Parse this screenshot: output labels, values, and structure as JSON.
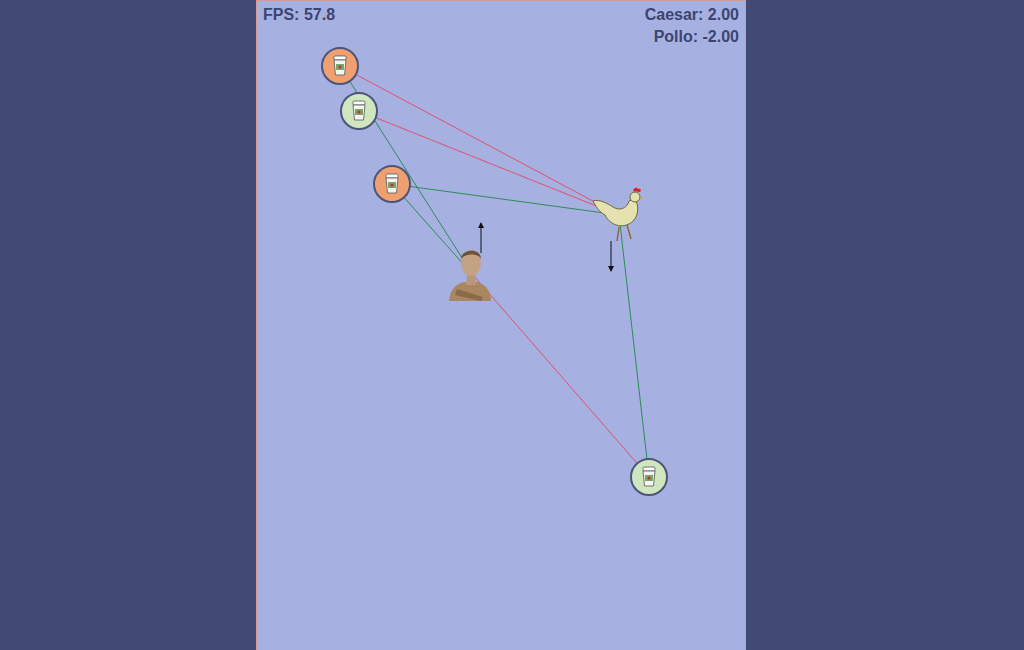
{
  "hud": {
    "fps": "FPS: 57.8",
    "scores": [
      {
        "label": "Caesar: 2.00"
      },
      {
        "label": "Pollo: -2.00"
      }
    ]
  },
  "players": [
    {
      "kind": "statue",
      "heading": "up"
    },
    {
      "kind": "chicken",
      "heading": "down"
    }
  ],
  "tokens": [
    {
      "color": "#f0a070"
    },
    {
      "color": "#cfe6bf"
    },
    {
      "color": "#f0a070"
    },
    {
      "color": "#cfe6bf"
    }
  ],
  "links": [
    {
      "token": 0,
      "player": 1,
      "color": "#e0506a"
    },
    {
      "token": 1,
      "player": 1,
      "color": "#e0506a"
    },
    {
      "token": 2,
      "player": 1,
      "color": "#2e8a5a"
    },
    {
      "token": 0,
      "player": 0,
      "color": "#2e8a5a"
    },
    {
      "token": 2,
      "player": 0,
      "color": "#2e8a5a"
    },
    {
      "token": 3,
      "player": 0,
      "color": "#e0506a"
    },
    {
      "token": 3,
      "player": 1,
      "color": "#2e8a5a"
    }
  ]
}
